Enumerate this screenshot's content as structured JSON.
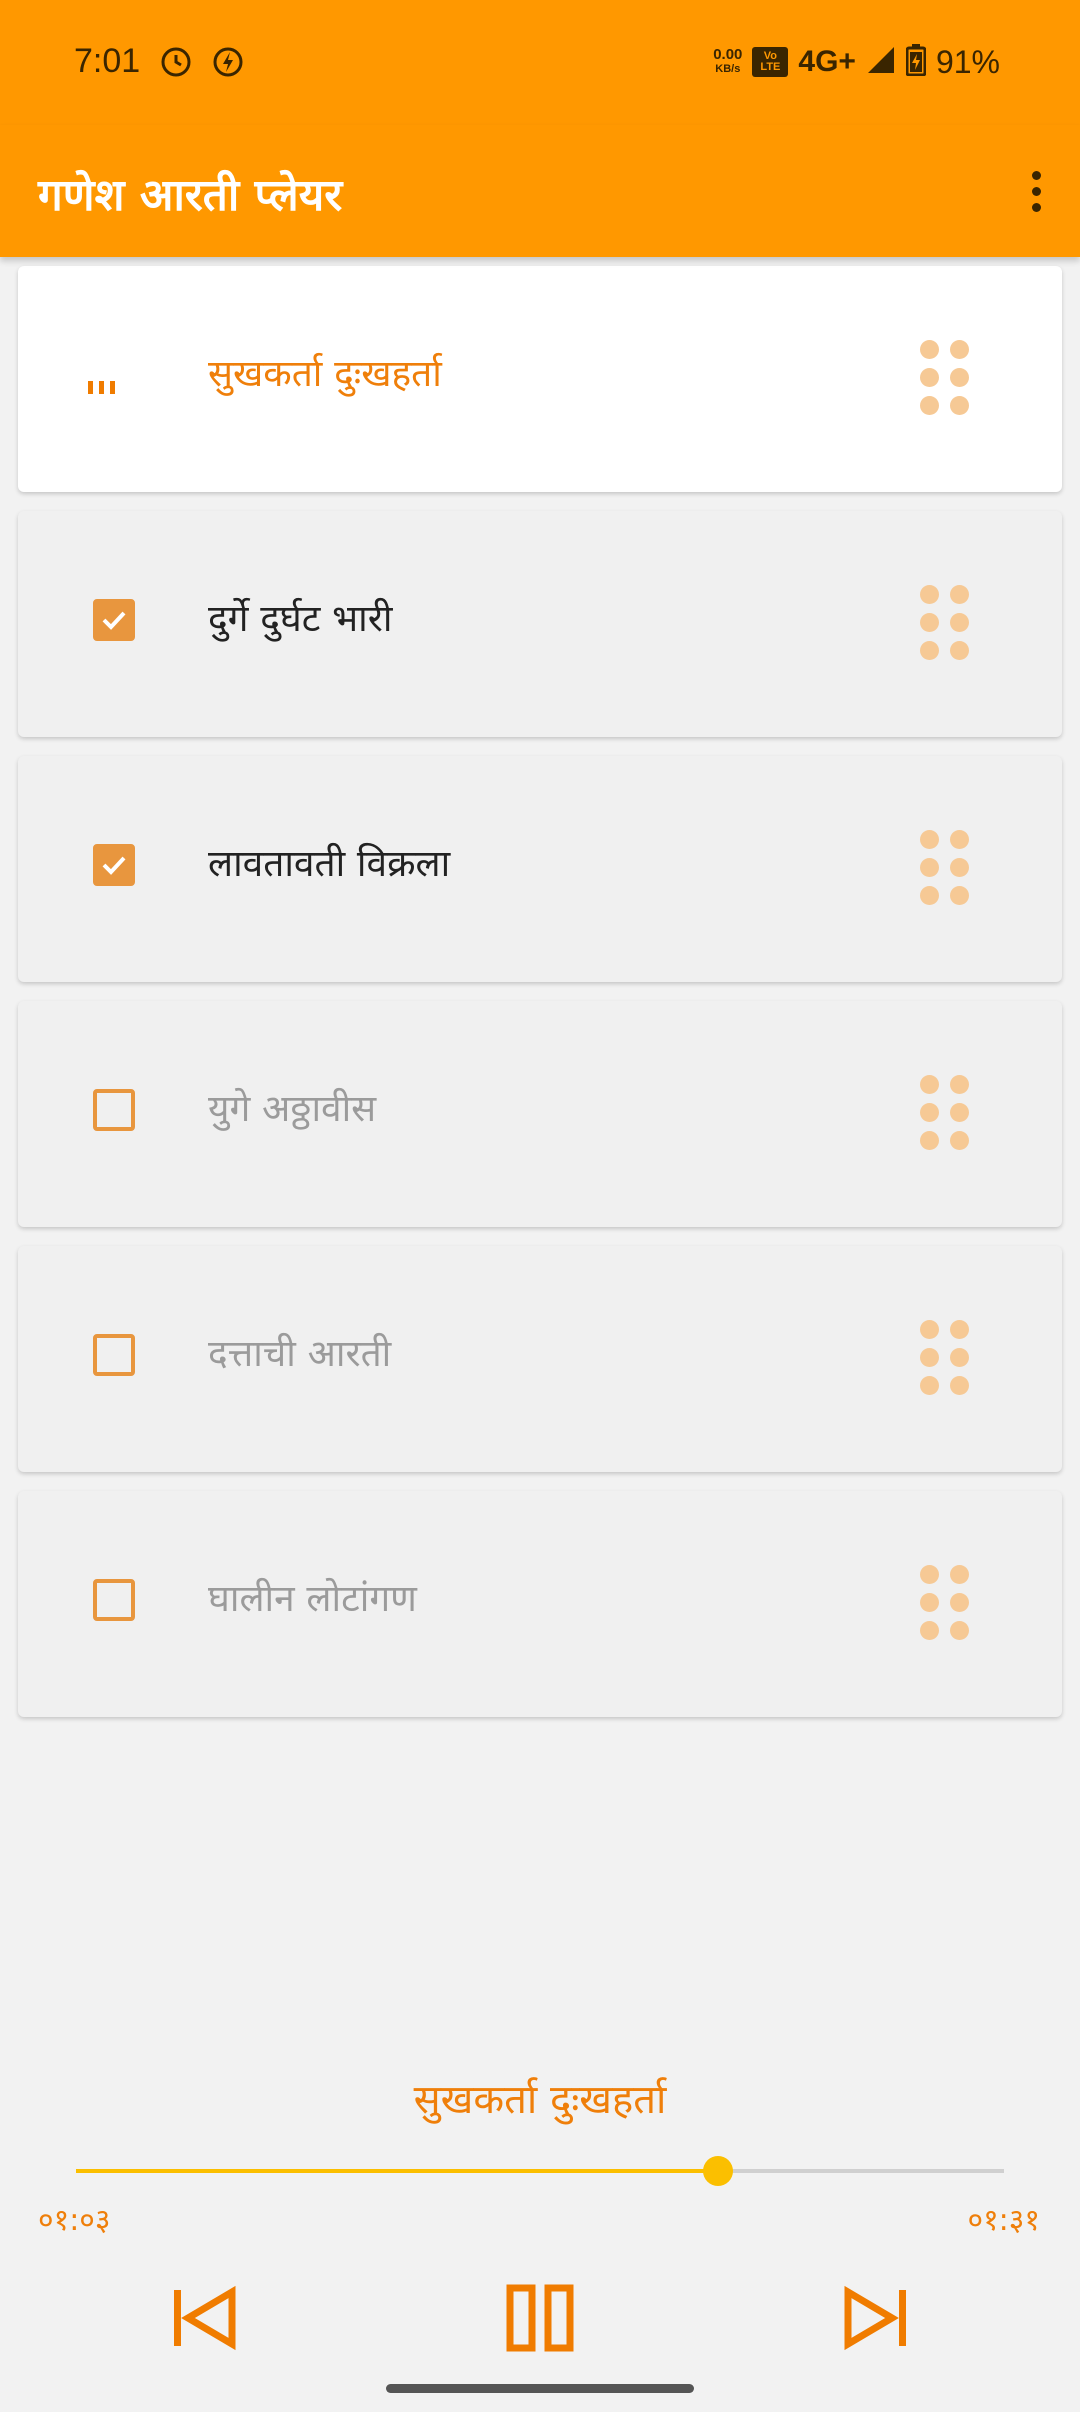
{
  "status_bar": {
    "time": "7:01",
    "speed_value": "0.00",
    "speed_unit": "KB/s",
    "volte_top": "Vo",
    "volte_bottom": "LTE",
    "network": "4G+",
    "battery": "91%",
    "icons": [
      "timer-icon",
      "flash-icon",
      "signal-icon",
      "battery-charging-icon"
    ]
  },
  "app_bar": {
    "title": "गणेश आरती प्लेयर",
    "menu_icon": "overflow-menu-icon"
  },
  "playlist": [
    {
      "title": "सुखकर्ता दुःखहर्ता",
      "state": "playing"
    },
    {
      "title": "दुर्गे दुर्घट भारी",
      "state": "checked"
    },
    {
      "title": "लावतावती विक्रला",
      "state": "checked"
    },
    {
      "title": "युगे अठ्ठावीस",
      "state": "unchecked"
    },
    {
      "title": "दत्ताची आरती",
      "state": "unchecked"
    },
    {
      "title": "घालीन लोटांगण",
      "state": "unchecked"
    }
  ],
  "player": {
    "now_playing": "सुखकर्ता दुःखहर्ता",
    "current_time": "०१:०३",
    "total_time": "०१:३१",
    "progress_fraction": 0.692
  },
  "colors": {
    "accent": "#ff9800",
    "playing_text": "#ef7f0a",
    "checkbox": "#e8963e",
    "drag_dot": "#f6c995",
    "seek": "#fbbf00"
  }
}
